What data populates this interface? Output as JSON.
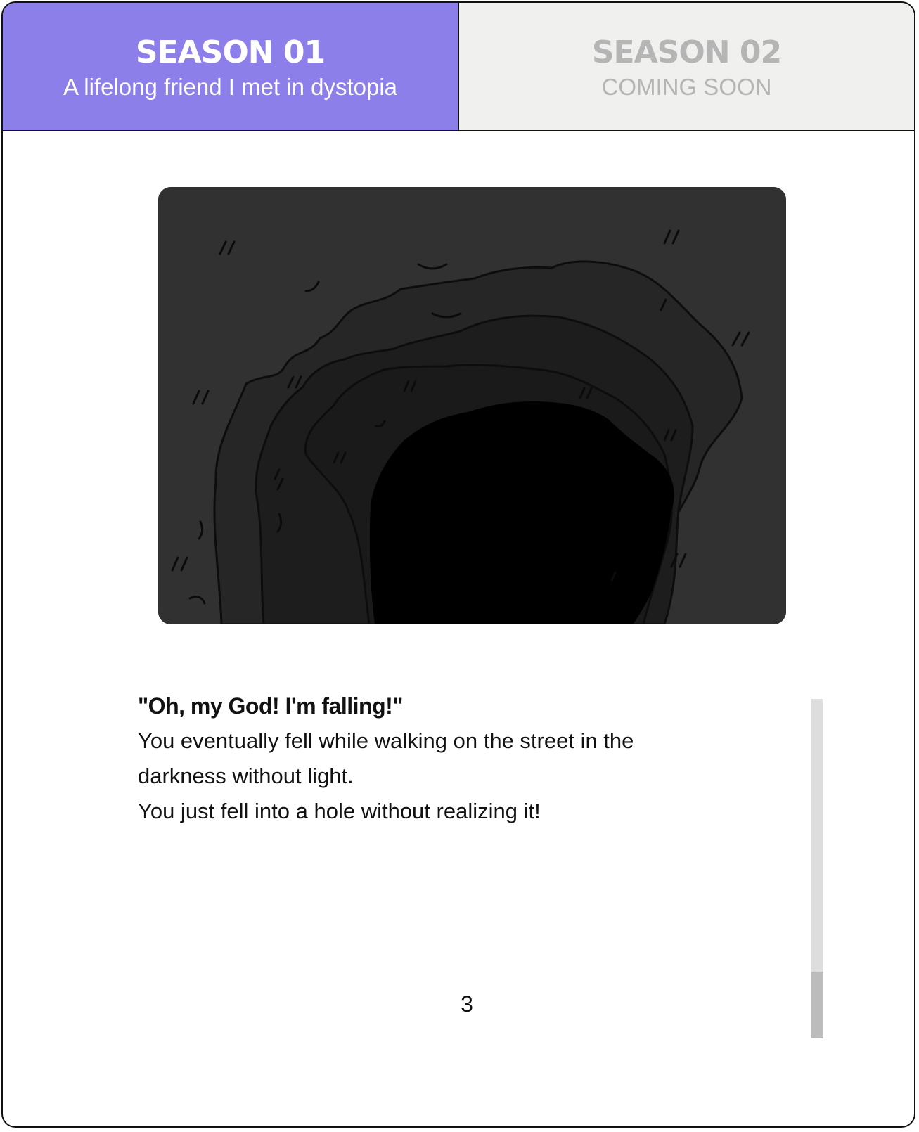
{
  "tabs": [
    {
      "title": "SEASON 01",
      "subtitle": "A lifelong friend I met in dystopia",
      "active": true
    },
    {
      "title": "SEASON 02",
      "subtitle": "COMING SOON",
      "active": false
    }
  ],
  "illustration": {
    "subject": "dark hole in the ground",
    "colors": {
      "background": "#313131",
      "ring2": "#242424",
      "ring3": "#1c1c1c",
      "center": "#000000"
    }
  },
  "story": {
    "quote": "\"Oh, my God! I'm falling!\"",
    "lines": [
      "You eventually fell while walking on the street in the",
      "darkness without light.",
      "You just fell into a hole without realizing it!"
    ]
  },
  "page": {
    "number": "3"
  },
  "scroll": {
    "position_fraction": 1.0,
    "visible_fraction": 0.2
  },
  "colors": {
    "accent": "#8d7fea",
    "inactive_tab": "#f0f0ee",
    "inactive_text": "#b5b5b5",
    "border": "#111111"
  }
}
